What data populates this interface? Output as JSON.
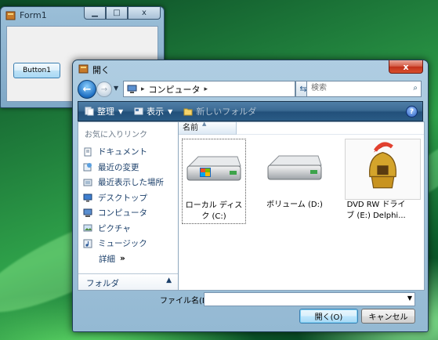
{
  "form1": {
    "title": "Form1",
    "button1_label": "Button1"
  },
  "dialog": {
    "title": "開く",
    "close_label": "x",
    "address": {
      "crumb": "コンピュータ"
    },
    "search_placeholder": "検索",
    "toolbar": {
      "organize_label": "整理",
      "view_label": "表示",
      "new_folder_label": "新しいフォルダ",
      "help_label": "?"
    },
    "left_pane": {
      "favorites_heading": "お気に入りリンク",
      "items": [
        {
          "label": "ドキュメント",
          "icon": "documents-icon"
        },
        {
          "label": "最近の変更",
          "icon": "recent-changes-icon"
        },
        {
          "label": "最近表示した場所",
          "icon": "recent-places-icon"
        },
        {
          "label": "デスクトップ",
          "icon": "desktop-icon"
        },
        {
          "label": "コンピュータ",
          "icon": "computer-icon"
        },
        {
          "label": "ピクチャ",
          "icon": "pictures-icon"
        },
        {
          "label": "ミュージック",
          "icon": "music-icon"
        }
      ],
      "more_label": "詳細",
      "folders_label": "フォルダ"
    },
    "column_header": "名前",
    "drives": [
      {
        "label": "ローカル ディスク (C:)",
        "icon": "windows-drive-icon"
      },
      {
        "label": "ボリューム (D:)",
        "icon": "hard-drive-icon"
      },
      {
        "label": "DVD RW ドライブ (E:) Delphi...",
        "icon": "delphi-helmet-icon"
      }
    ],
    "filename_label": "ファイル名(N):",
    "filename_value": "",
    "open_button": "開く(O)",
    "cancel_button": "キャンセル"
  },
  "colors": {
    "desktop_green": "#1e7a3a",
    "toolbar_blue": "#2a5b86",
    "link_text": "#1b3f6a"
  }
}
